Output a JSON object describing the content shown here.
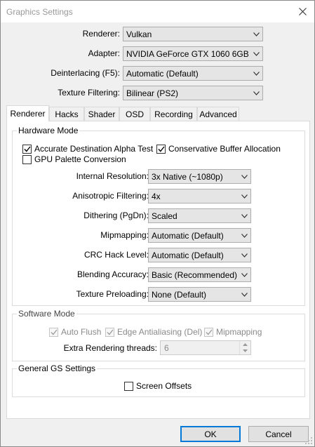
{
  "window": {
    "title": "Graphics Settings"
  },
  "top": {
    "renderer": {
      "label": "Renderer:",
      "value": "Vulkan"
    },
    "adapter": {
      "label": "Adapter:",
      "value": "NVIDIA GeForce GTX 1060 6GB"
    },
    "deinterlacing": {
      "label": "Deinterlacing (F5):",
      "value": "Automatic (Default)"
    },
    "texture_filtering": {
      "label": "Texture Filtering:",
      "value": "Bilinear (PS2)"
    }
  },
  "tabs": [
    "Renderer",
    "Hacks",
    "Shader",
    "OSD",
    "Recording",
    "Advanced"
  ],
  "hardware": {
    "title": "Hardware Mode",
    "accurate_dest_alpha": {
      "label": "Accurate Destination Alpha Test",
      "checked": true
    },
    "conservative_buffer": {
      "label": "Conservative Buffer Allocation",
      "checked": true
    },
    "gpu_palette": {
      "label": "GPU Palette Conversion",
      "checked": false
    },
    "internal_resolution": {
      "label": "Internal Resolution:",
      "value": "3x Native (~1080p)"
    },
    "anisotropic": {
      "label": "Anisotropic Filtering:",
      "value": "4x"
    },
    "dithering": {
      "label": "Dithering (PgDn):",
      "value": "Scaled"
    },
    "mipmapping": {
      "label": "Mipmapping:",
      "value": "Automatic (Default)"
    },
    "crc_hack": {
      "label": "CRC Hack Level:",
      "value": "Automatic (Default)"
    },
    "blending": {
      "label": "Blending Accuracy:",
      "value": "Basic (Recommended)"
    },
    "texture_preloading": {
      "label": "Texture Preloading:",
      "value": "None (Default)"
    }
  },
  "software": {
    "title": "Software Mode",
    "auto_flush": {
      "label": "Auto Flush",
      "checked": true
    },
    "edge_aa": {
      "label": "Edge Antialiasing (Del)",
      "checked": true
    },
    "mipmapping": {
      "label": "Mipmapping",
      "checked": true
    },
    "extra_threads": {
      "label": "Extra Rendering threads:",
      "value": "6"
    }
  },
  "general": {
    "title": "General GS Settings",
    "screen_offsets": {
      "label": "Screen Offsets",
      "checked": false
    }
  },
  "buttons": {
    "ok": "OK",
    "cancel": "Cancel"
  }
}
